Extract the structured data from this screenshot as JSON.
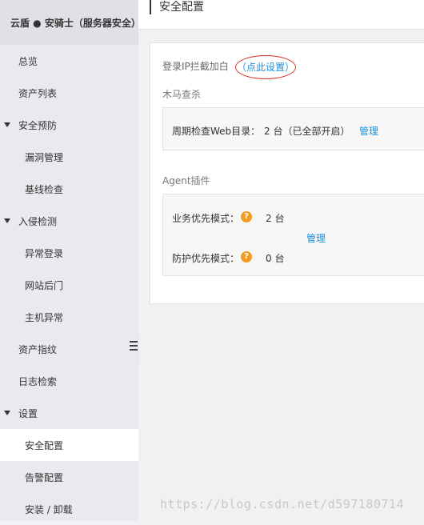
{
  "sidebar": {
    "header": "云盾 ● 安骑士（服务器安全）",
    "items": [
      {
        "label": "总览"
      },
      {
        "label": "资产列表"
      },
      {
        "label": "安全预防"
      },
      {
        "label": "漏洞管理"
      },
      {
        "label": "基线检查"
      },
      {
        "label": "入侵检测"
      },
      {
        "label": "异常登录"
      },
      {
        "label": "网站后门"
      },
      {
        "label": "主机异常"
      },
      {
        "label": "资产指纹"
      },
      {
        "label": "日志检索"
      },
      {
        "label": "设置"
      },
      {
        "label": "安全配置"
      },
      {
        "label": "告警配置"
      },
      {
        "label": "安装 / 卸载"
      }
    ]
  },
  "page": {
    "title": "安全配置"
  },
  "ip_block": {
    "label": "登录IP拦截加白",
    "link": "（点此设置）"
  },
  "trojan": {
    "title": "木马查杀",
    "label": "周期检查Web目录：",
    "value": "2 台（已全部开启）",
    "manage": "管理"
  },
  "agent": {
    "title": "Agent插件",
    "business_label": "业务优先模式：",
    "business_value": "2 台",
    "protect_label": "防护优先模式：",
    "protect_value": "0 台",
    "help_icon": "?",
    "manage": "管理"
  },
  "watermark": "https://blog.csdn.net/d597180714",
  "colors": {
    "link": "#1e8fdc",
    "help": "#f39c1f",
    "highlight_circle": "#d9342b"
  }
}
